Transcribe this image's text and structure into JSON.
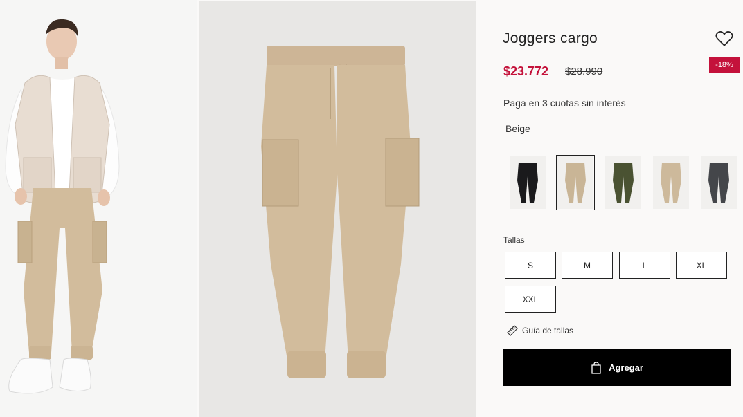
{
  "product": {
    "title": "Joggers cargo",
    "price_now": "$23.772",
    "price_old": "$28.990",
    "discount": "-18%",
    "installments": "Paga en 3 cuotas sin interés",
    "color_name": "Beige"
  },
  "swatches": [
    {
      "name": "black",
      "color": "#1a1a1c"
    },
    {
      "name": "beige",
      "color": "#c9b596",
      "selected": true
    },
    {
      "name": "olive",
      "color": "#4a5232"
    },
    {
      "name": "sand",
      "color": "#cdb99b"
    },
    {
      "name": "grey",
      "color": "#44464a"
    }
  ],
  "sizes": {
    "label": "Tallas",
    "options": [
      "S",
      "M",
      "L",
      "XL",
      "XXL"
    ]
  },
  "size_guide": "Guía de tallas",
  "add_to_cart": "Agregar",
  "colors": {
    "accent": "#c4123b",
    "cta": "#000000",
    "pants": "#d2bc9c"
  }
}
